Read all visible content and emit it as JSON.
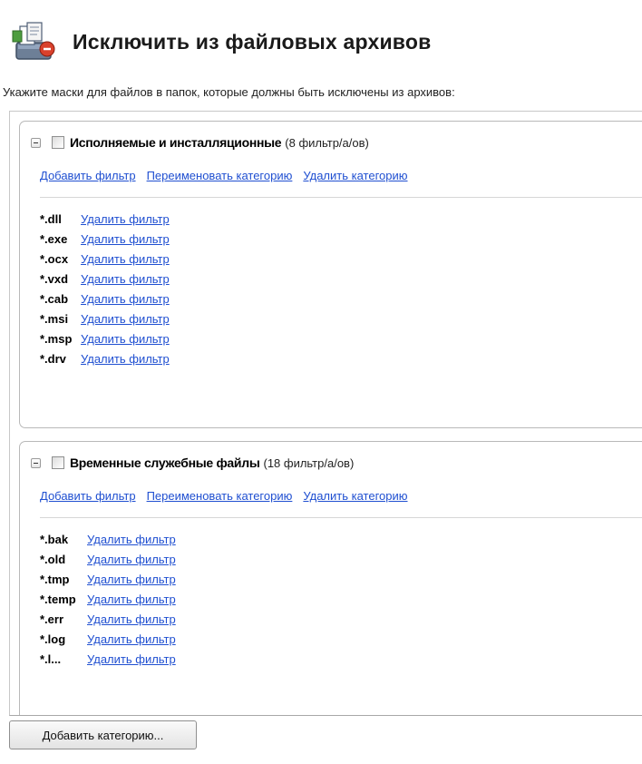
{
  "header": {
    "title": "Исключить из файловых архивов",
    "icon": "exclude-files-icon"
  },
  "subtitle": "Укажите маски для файлов в папок, которые должны быть исключены из архивов:",
  "labels": {
    "add_filter": "Добавить фильтр",
    "rename_category": "Переименовать категорию",
    "delete_category": "Удалить категорию",
    "delete_filter": "Удалить фильтр"
  },
  "categories": [
    {
      "name": "Исполняемые и инсталляционные",
      "count": "(8 фильтр/а/ов)",
      "filters": [
        "*.dll",
        "*.exe",
        "*.ocx",
        "*.vxd",
        "*.cab",
        "*.msi",
        "*.msp",
        "*.drv"
      ]
    },
    {
      "name": "Временные служебные файлы",
      "count": "(18 фильтр/а/ов)",
      "filters": [
        "*.bak",
        "*.old",
        "*.tmp",
        "*.temp",
        "*.err",
        "*.log",
        "*.l..."
      ]
    }
  ],
  "footer": {
    "add_category": "Добавить категорию..."
  }
}
